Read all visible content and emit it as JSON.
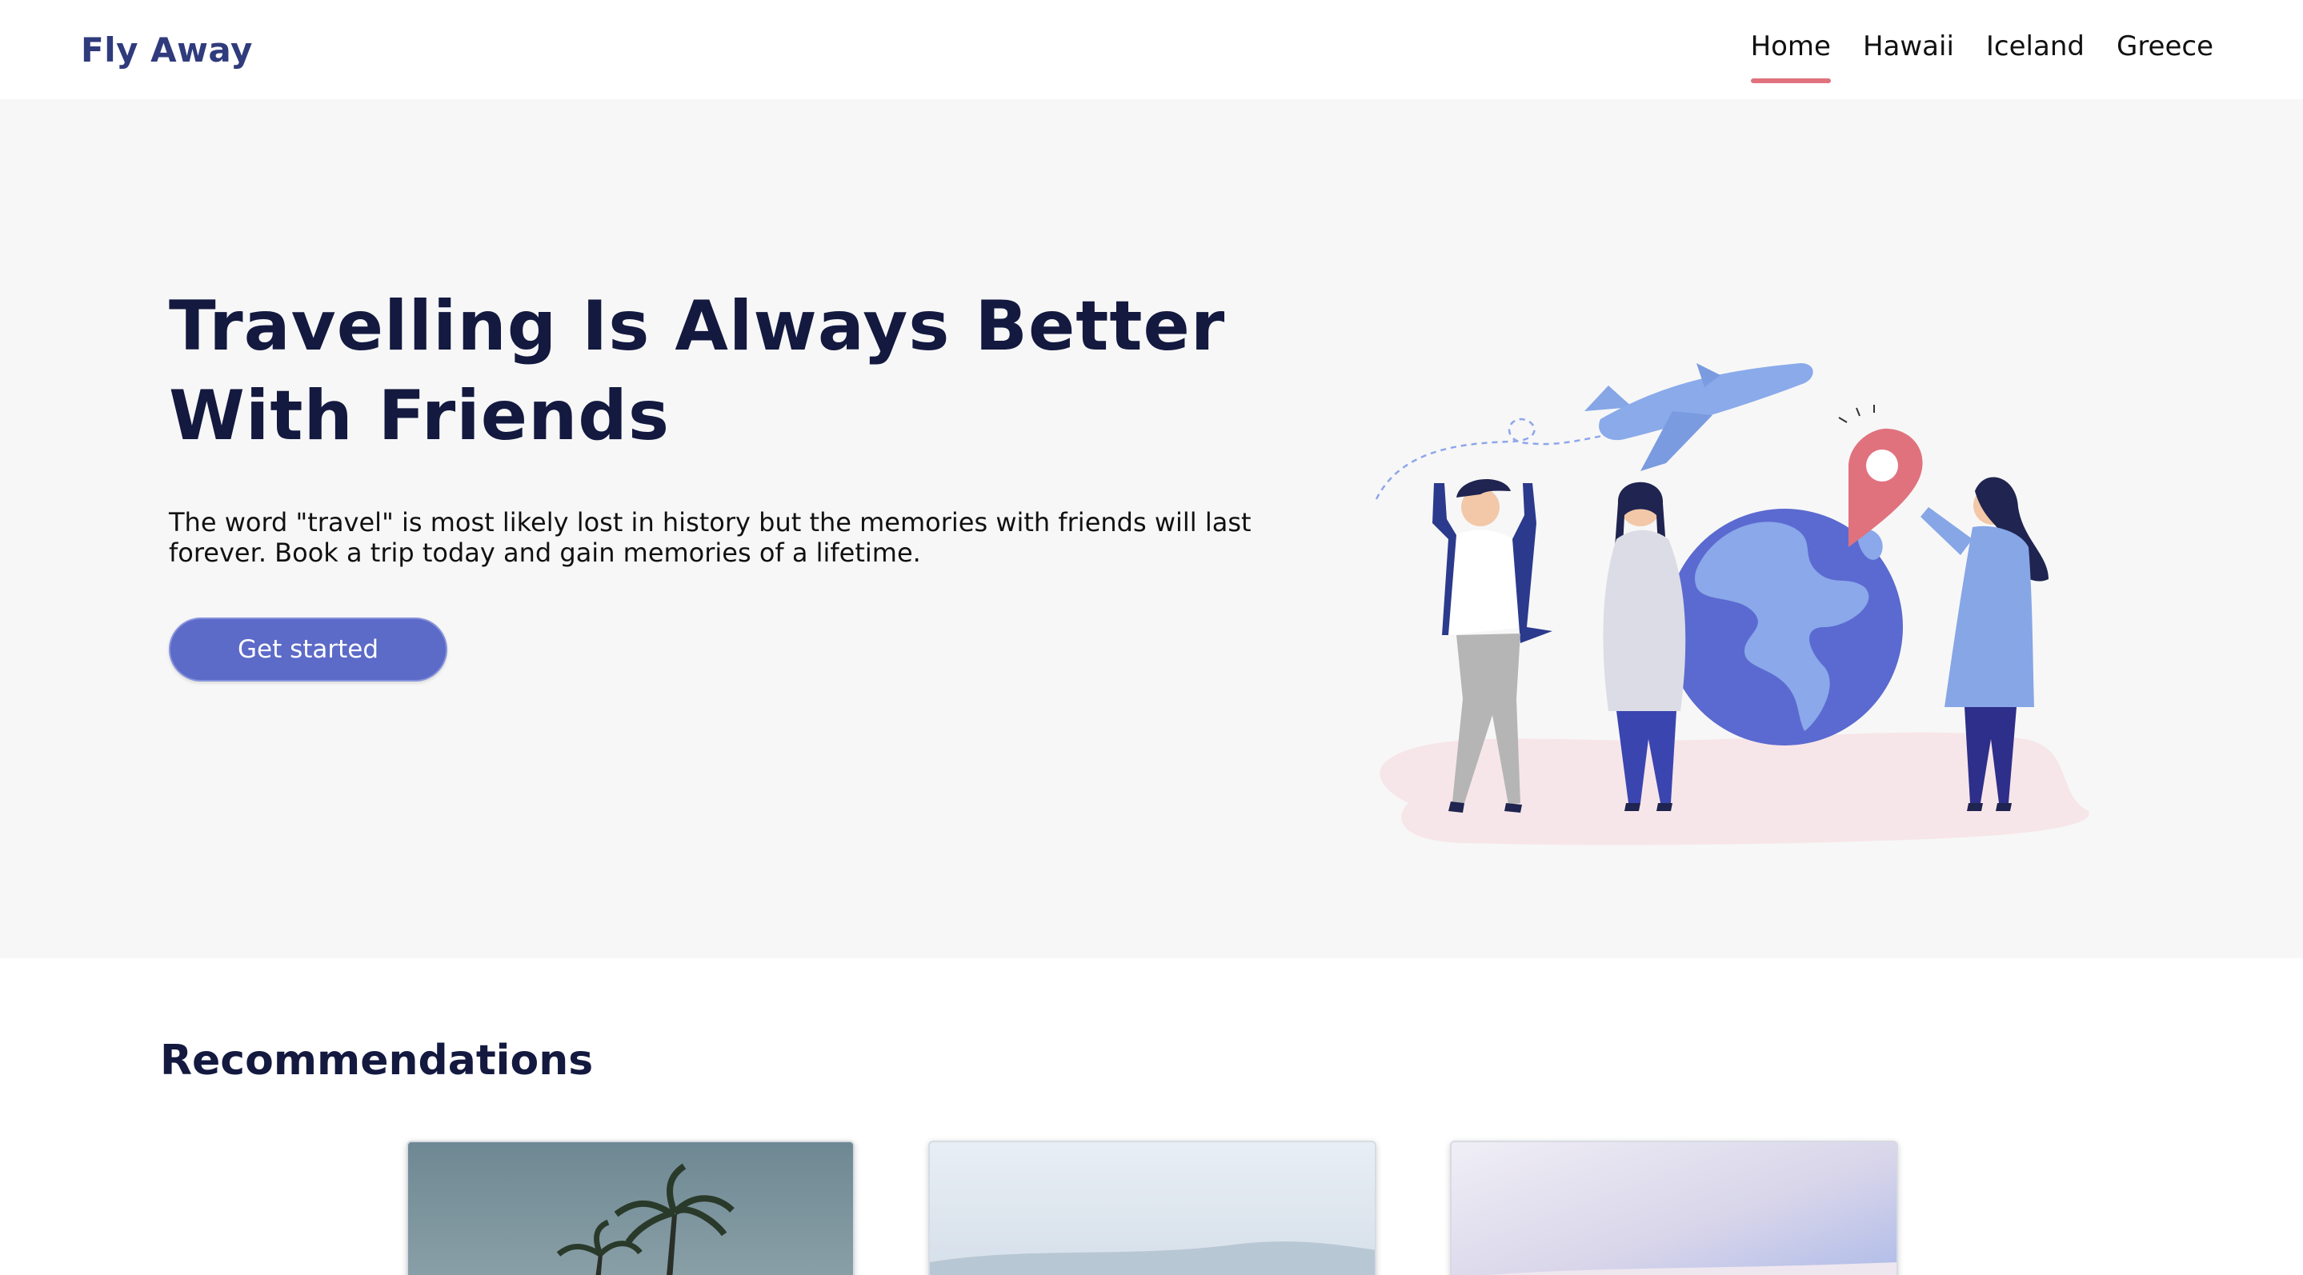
{
  "navbar": {
    "brand": "Fly Away",
    "items": [
      {
        "label": "Home",
        "active": true
      },
      {
        "label": "Hawaii",
        "active": false
      },
      {
        "label": "Iceland",
        "active": false
      },
      {
        "label": "Greece",
        "active": false
      }
    ]
  },
  "hero": {
    "title": "Travelling Is Always Better With Friends",
    "description": "The word \"travel\" is most likely lost in history but the memories with friends will last forever. Book a trip today and gain memories of a lifetime.",
    "cta_label": "Get started",
    "illustration_icon": "travel-friends-illustration"
  },
  "recommendations": {
    "title": "Recommendations",
    "cards": [
      {
        "image": "palm-trees-photo"
      },
      {
        "image": "misty-landscape-photo"
      },
      {
        "image": "pastel-sky-photo"
      }
    ]
  },
  "colors": {
    "brand": "#2f3b7c",
    "accent_underline": "#e0727e",
    "button": "#5c6ac8",
    "hero_bg": "#f7f7f7",
    "heading": "#13193f"
  }
}
